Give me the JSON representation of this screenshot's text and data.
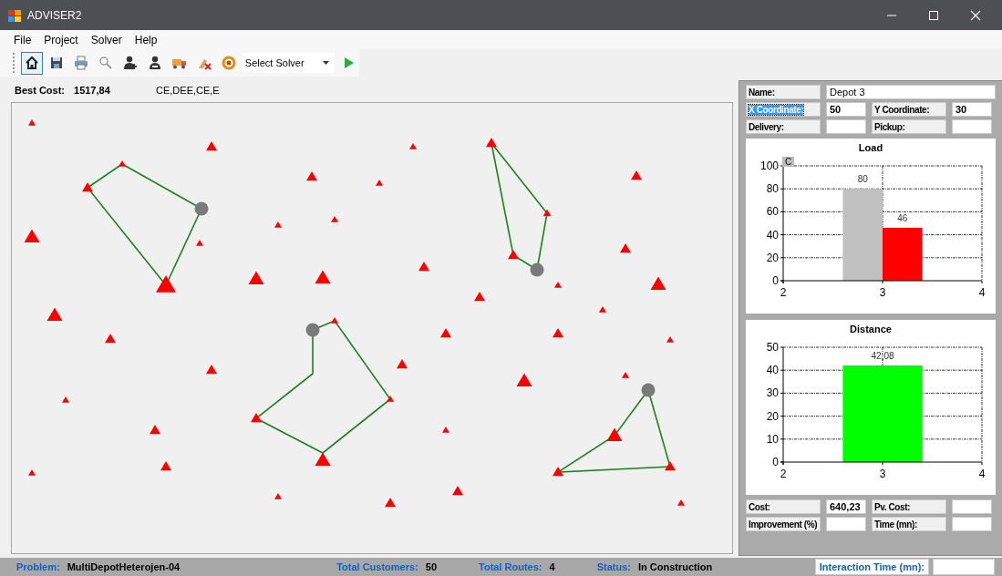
{
  "window": {
    "title": "ADVISER2"
  },
  "menu": [
    "File",
    "Project",
    "Solver",
    "Help"
  ],
  "toolbar": {
    "buttons": [
      {
        "kind": "home",
        "selected": true
      },
      {
        "kind": "save",
        "selected": false
      },
      {
        "kind": "print",
        "selected": false
      },
      {
        "kind": "search",
        "selected": false
      },
      {
        "kind": "add-user",
        "selected": false
      },
      {
        "kind": "user",
        "selected": false
      },
      {
        "kind": "truck",
        "selected": false
      },
      {
        "kind": "eraser",
        "selected": false
      },
      {
        "kind": "refresh",
        "selected": false
      }
    ],
    "solver_select": {
      "value": "Select Solver"
    },
    "run_button": {
      "kind": "play"
    }
  },
  "summary": {
    "best_cost_label": "Best Cost:",
    "best_cost_value": "1517,84",
    "sequence": "CE,DEE,CE,E"
  },
  "details": {
    "rows": [
      [
        {
          "label": "Name:",
          "value": "Depot 3",
          "highlighted": false
        }
      ],
      [
        {
          "label": "X Coordinate:",
          "value": "50",
          "highlighted": true
        },
        {
          "label": "Y Coordinate:",
          "value": "30",
          "highlighted": false
        }
      ],
      [
        {
          "label": "Delivery:",
          "highlighted": false
        },
        {
          "label": "Pickup:",
          "highlighted": false
        }
      ]
    ]
  },
  "load_chart": {
    "corner_label": "C",
    "chart_data": {
      "type": "bar",
      "title": "Load",
      "x": [
        2.8,
        3.2
      ],
      "series": [
        {
          "color": "#c0c0c0",
          "values": [
            80,
            null
          ]
        },
        {
          "color": "#ff0000",
          "values": [
            null,
            46
          ]
        }
      ],
      "xlim": [
        2,
        4
      ],
      "ylim": [
        0,
        100
      ],
      "xticks": [
        2,
        3,
        4
      ],
      "yticks": [
        0,
        20,
        40,
        60,
        80,
        100
      ],
      "grid": true,
      "value_labels": [
        "80",
        "46"
      ]
    }
  },
  "distance_chart": {
    "chart_data": {
      "type": "bar",
      "title": "Distance",
      "x": [
        3
      ],
      "series": [
        {
          "color": "#00ff00",
          "values": [
            42.08
          ]
        }
      ],
      "xlim": [
        2,
        4
      ],
      "ylim": [
        0,
        50
      ],
      "xticks": [
        2,
        3,
        4
      ],
      "yticks": [
        0,
        10,
        20,
        30,
        40,
        50
      ],
      "grid": true,
      "value_labels": [
        "42,08"
      ]
    }
  },
  "results": {
    "rows": [
      [
        {
          "label": "Cost:",
          "value": "640,23",
          "highlighted": false
        },
        {
          "label": "Pv. Cost:",
          "highlighted": false
        }
      ],
      [
        {
          "label": "Improvement (%)",
          "highlighted": false
        },
        {
          "label": "Time (mn):",
          "highlighted": false
        }
      ]
    ]
  },
  "status_bar": {
    "items": [
      {
        "label": "Problem:",
        "value": "MultiDepotHeterojen-04"
      },
      {
        "label": "Total Customers:",
        "value": "50"
      },
      {
        "label": "Total Routes:",
        "value": "4"
      },
      {
        "label": "Status:",
        "value": "In Construction"
      }
    ],
    "interaction_time": {
      "label": "Interaction Time (mn):"
    }
  }
}
